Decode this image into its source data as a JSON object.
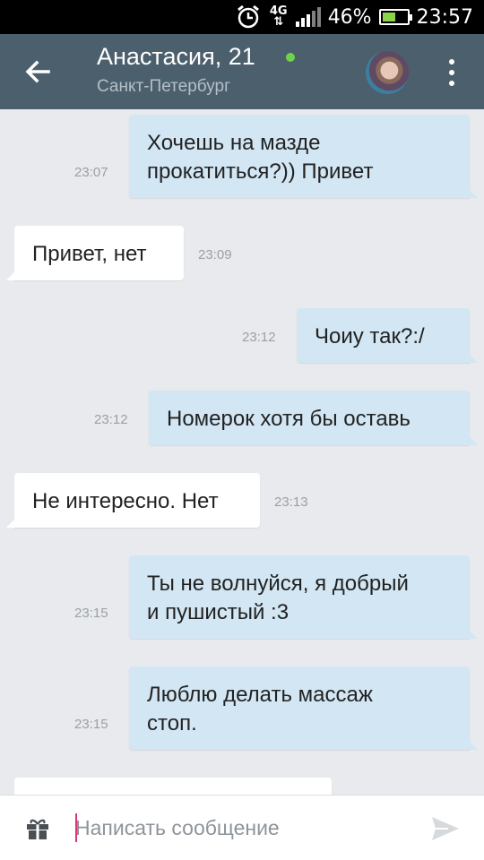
{
  "statusbar": {
    "network": "4G",
    "battery_percent": "46%",
    "time": "23:57",
    "icons": [
      "alarm-icon",
      "network-4g-icon",
      "signal-icon",
      "battery-icon"
    ]
  },
  "header": {
    "title": "Анастасия, 21",
    "subtitle": "Санкт-Петербург",
    "online_color": "#6fd34a",
    "background": "#4c5f6c"
  },
  "messages": [
    {
      "direction": "out",
      "text_lines": [
        "Хочешь на мазде",
        "прокатиться?)) Привет"
      ],
      "time": "23:07"
    },
    {
      "direction": "in",
      "text_lines": [
        "Привет, нет"
      ],
      "time": "23:09"
    },
    {
      "direction": "out",
      "text_lines": [
        "Чоиу так?:/"
      ],
      "time": "23:12"
    },
    {
      "direction": "out",
      "text_lines": [
        "Номерок хотя бы оставь"
      ],
      "time": "23:12"
    },
    {
      "direction": "in",
      "text_lines": [
        "Не интересно. Нет"
      ],
      "time": "23:13"
    },
    {
      "direction": "out",
      "text_lines": [
        "Ты не волнуйся, я добрый",
        "и пушистый :3"
      ],
      "time": "23:15"
    },
    {
      "direction": "out",
      "text_lines": [
        "Люблю делать массаж",
        "стоп."
      ],
      "time": "23:15"
    }
  ],
  "composer": {
    "placeholder": "Написать сообщение"
  },
  "colors": {
    "outgoing_bubble": "#d2e6f3",
    "incoming_bubble": "#ffffff",
    "chat_background": "#e8eaed",
    "cursor": "#e0337a"
  }
}
